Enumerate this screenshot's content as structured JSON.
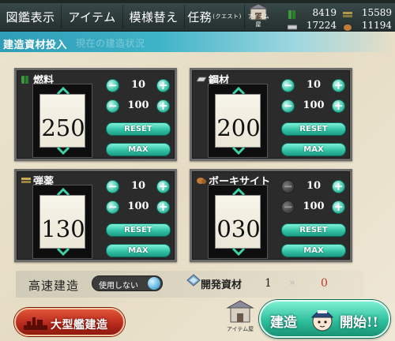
{
  "menu": {
    "tabs": [
      {
        "label": "図鑑表示",
        "suffix": ""
      },
      {
        "label": "アイテム",
        "suffix": ""
      },
      {
        "label": "模様替え",
        "suffix": ""
      },
      {
        "label": "任務",
        "suffix": "(クエスト)"
      }
    ],
    "item_shop_label": "アイテム屋"
  },
  "resources_top": [
    {
      "name": "fuel",
      "value": "8419",
      "color": "#3c9a3c"
    },
    {
      "name": "ammo",
      "value": "15589",
      "color": "#8a7a3a"
    },
    {
      "name": "steel",
      "value": "17224",
      "color": "#c8c8c8"
    },
    {
      "name": "bauxite",
      "value": "11194",
      "color": "#b06a30"
    }
  ],
  "header": {
    "title": "建造資材投入",
    "subtitle": "現在の建造状況"
  },
  "panels": [
    {
      "name": "燃料",
      "icon": "fuel-icon",
      "icon_color": "#3c9a3c",
      "value": "250",
      "step_small": "10",
      "step_large": "100",
      "reset": "RESET",
      "max": "MAX",
      "disabled": false
    },
    {
      "name": "鋼材",
      "icon": "steel-icon",
      "icon_color": "#c8c8c8",
      "value": "200",
      "step_small": "10",
      "step_large": "100",
      "reset": "RESET",
      "max": "MAX",
      "disabled": false
    },
    {
      "name": "弾薬",
      "icon": "ammo-icon",
      "icon_color": "#b59a4a",
      "value": "130",
      "step_small": "10",
      "step_large": "100",
      "reset": "RESET",
      "max": "MAX",
      "disabled": false
    },
    {
      "name": "ボーキサイト",
      "icon": "bauxite-icon",
      "icon_color": "#c07a3a",
      "value": "030",
      "step_small": "10",
      "step_large": "100",
      "reset": "RESET",
      "max": "MAX",
      "disabled": true
    }
  ],
  "speed_build": {
    "label": "高速建造",
    "toggle": "使用しない"
  },
  "dev_material": {
    "label": "開発資材",
    "current": "1",
    "arrow": "»",
    "after": "0"
  },
  "buttons": {
    "large_build": "大型艦建造",
    "start_left": "建造",
    "start_right": "開始!!",
    "item_shop": "アイテム屋"
  }
}
